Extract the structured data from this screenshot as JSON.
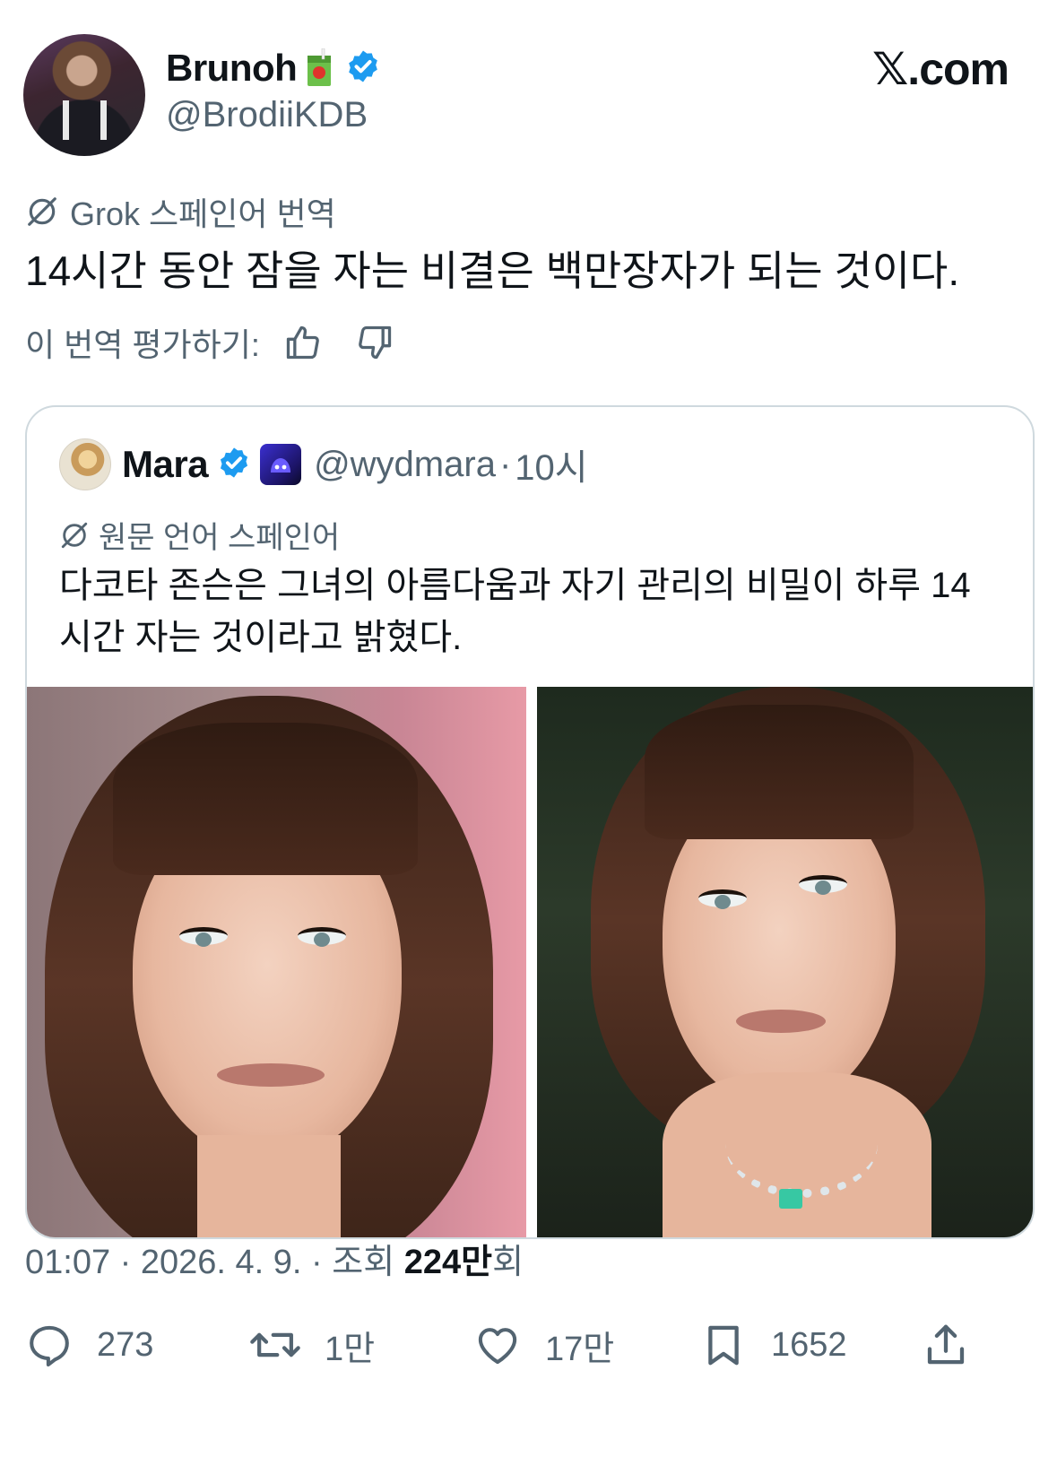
{
  "author": {
    "display_name": "Brunoh",
    "handle": "@BrodiiKDB",
    "verified": true
  },
  "brand": "𝕏.com",
  "translation": {
    "label": "Grok 스페인어 번역",
    "text": "14시간 동안 잠을 자는 비결은 백만장자가 되는 것이다.",
    "rate_prompt": "이 번역 평가하기:"
  },
  "quoted": {
    "display_name": "Mara",
    "handle": "@wydmara",
    "separator": "·",
    "time": "10시",
    "original_language_label": "원문 언어 스페인어",
    "text": "다코타 존슨은 그녀의 아름다움과 자기 관리의 비밀이 하루 14시간 자는 것이라고 밝혔다."
  },
  "meta": {
    "time": "01:07",
    "dot1": " · ",
    "date": "2026. 4. 9.",
    "dot2": " · ",
    "views_prefix": "조회 ",
    "views_count": "224만",
    "views_suffix": "회"
  },
  "actions": {
    "replies": "273",
    "reposts": "1만",
    "likes": "17만",
    "bookmarks": "1652"
  },
  "colors": {
    "verified_blue": "#1d9bf0",
    "secondary_text": "#536471",
    "primary_text": "#0f1419",
    "border": "#cfd9de"
  }
}
